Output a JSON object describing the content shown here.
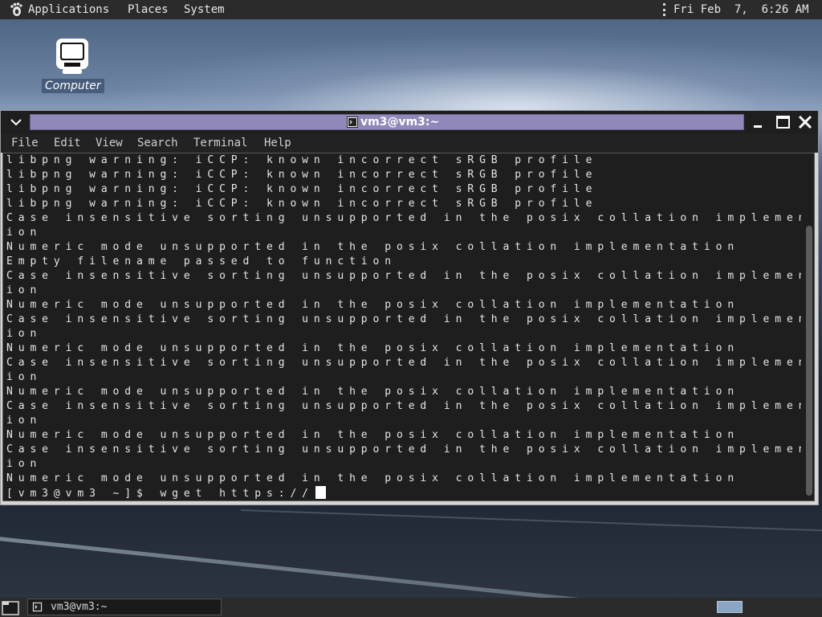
{
  "top_panel": {
    "menus": [
      "Applications",
      "Places",
      "System"
    ],
    "clock": "Fri Feb  7,  6:26 AM",
    "logo_icon": "gnome-foot-icon"
  },
  "desktop": {
    "icons": [
      {
        "label": "Computer",
        "icon": "computer-monitor-icon"
      }
    ]
  },
  "window": {
    "title": "vm3@vm3:~",
    "title_icon": "terminal-icon",
    "controls": [
      "minimize-icon",
      "maximize-icon",
      "close-icon"
    ],
    "menus": [
      "File",
      "Edit",
      "View",
      "Search",
      "Terminal",
      "Help"
    ],
    "terminal_lines": [
      "libpng warning: iCCP: known incorrect sRGB profile",
      "libpng warning: iCCP: known incorrect sRGB profile",
      "libpng warning: iCCP: known incorrect sRGB profile",
      "libpng warning: iCCP: known incorrect sRGB profile",
      "Case insensitive sorting unsupported in the posix collation implementat",
      "ion",
      "Numeric mode unsupported in the posix collation implementation",
      "Empty filename passed to function",
      "Case insensitive sorting unsupported in the posix collation implementat",
      "ion",
      "Numeric mode unsupported in the posix collation implementation",
      "Case insensitive sorting unsupported in the posix collation implementat",
      "ion",
      "Numeric mode unsupported in the posix collation implementation",
      "Case insensitive sorting unsupported in the posix collation implementat",
      "ion",
      "Numeric mode unsupported in the posix collation implementation",
      "Case insensitive sorting unsupported in the posix collation implementat",
      "ion",
      "Numeric mode unsupported in the posix collation implementation",
      "Case insensitive sorting unsupported in the posix collation implementat",
      "ion",
      "Numeric mode unsupported in the posix collation implementation"
    ],
    "prompt": "[vm3@vm3 ~]$ wget https://"
  },
  "bottom_panel": {
    "task_label": "vm3@vm3:~",
    "task_icon": "terminal-icon",
    "show_desktop_icon": "show-desktop-icon"
  },
  "colors": {
    "title_active": "#8f88b8",
    "terminal_bg": "#1e1e1e",
    "terminal_fg": "#e6e6e6",
    "panel_bg": "#2b2b2b",
    "workspace_active": "#8aa6c4"
  }
}
